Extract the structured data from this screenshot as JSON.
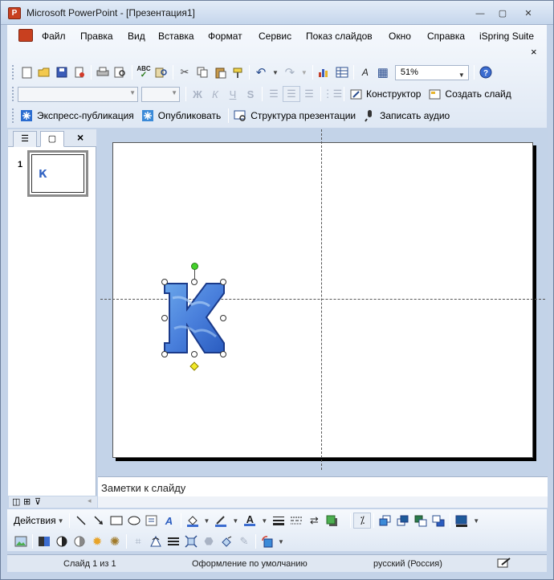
{
  "window": {
    "title": "Microsoft PowerPoint - [Презентация1]",
    "app_icon": "powerpoint-icon",
    "controls": [
      "minimize-icon",
      "restore-icon",
      "close-icon"
    ]
  },
  "menu": {
    "items": [
      "Файл",
      "Правка",
      "Вид",
      "Вставка",
      "Формат",
      "Сервис",
      "Показ слайдов",
      "Окно",
      "Справка",
      "iSpring Suite"
    ],
    "close_glyph": "×"
  },
  "standard_toolbar": {
    "zoom": "51%",
    "icons": [
      "new-icon",
      "open-icon",
      "save-icon",
      "permission-icon",
      "print-icon",
      "print-preview-icon",
      "spelling-icon",
      "research-icon",
      "cut-icon",
      "copy-icon",
      "paste-icon",
      "format-painter-icon",
      "undo-icon",
      "redo-icon",
      "chart-icon",
      "table-icon",
      "font-color-toggle-icon",
      "grid-icon",
      "help-icon"
    ]
  },
  "formatting_toolbar": {
    "bold": "Ж",
    "italic": "К",
    "underline": "Ч",
    "shadow": "S",
    "designer_label": "Конструктор",
    "new_slide_label": "Создать слайд"
  },
  "ispring_toolbar": {
    "quick_publish_label": "Экспресс-публикация",
    "publish_label": "Опубликовать",
    "structure_label": "Структура презентации",
    "record_audio_label": "Записать аудио"
  },
  "slides_pane": {
    "tab_outline_icon": "outline-icon",
    "tab_slides_icon": "slides-icon",
    "close_glyph": "×",
    "thumbnail_number": "1",
    "thumbnail_letter": "К"
  },
  "slide": {
    "wordart_letter": "К",
    "wordart_fill_start": "#6aa6ea",
    "wordart_fill_end": "#2a5cc0"
  },
  "notes": {
    "placeholder": "Заметки к слайду"
  },
  "drawing_toolbar": {
    "actions_label": "Действия"
  },
  "status": {
    "slide": "Слайд 1 из 1",
    "design": "Оформление по умолчанию",
    "language": "русский (Россия)"
  },
  "colors": {
    "chrome": "#c4d3e8",
    "toolbar": "#dfe8f4",
    "accent": "#2a4d8f"
  }
}
